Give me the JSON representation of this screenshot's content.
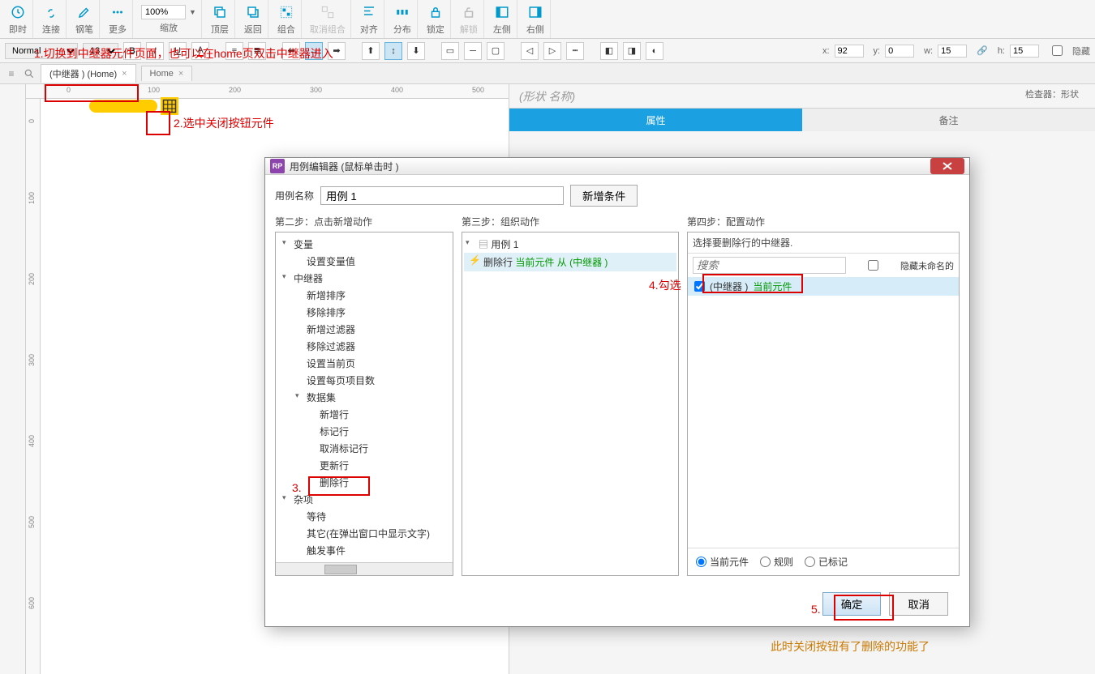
{
  "toolbar": {
    "groups": [
      {
        "label": "即时",
        "icon": "clock"
      },
      {
        "label": "连接",
        "icon": "link"
      },
      {
        "label": "钢笔",
        "icon": "pen"
      },
      {
        "label": "更多",
        "icon": "more"
      }
    ],
    "zoom": {
      "value": "100%",
      "label": "缩放"
    },
    "arrange": [
      {
        "label": "顶层",
        "icon": "front"
      },
      {
        "label": "返回",
        "icon": "back"
      },
      {
        "label": "组合",
        "icon": "group"
      },
      {
        "label": "取消组合",
        "icon": "ungroup"
      },
      {
        "label": "对齐",
        "icon": "align"
      },
      {
        "label": "分布",
        "icon": "distribute"
      },
      {
        "label": "锁定",
        "icon": "lock"
      },
      {
        "label": "解锁",
        "icon": "unlock"
      },
      {
        "label": "左侧",
        "icon": "left-panel"
      },
      {
        "label": "右侧",
        "icon": "right-panel"
      }
    ]
  },
  "format": {
    "style": "Normal",
    "font_size": "13",
    "x": "92",
    "y": "0",
    "w": "15",
    "h": "15",
    "hidden_label": "隐藏"
  },
  "tabs": {
    "active": "(中继器 ) (Home)",
    "inactive": "Home"
  },
  "ruler_h": [
    "0",
    "100",
    "200",
    "300",
    "400",
    "500"
  ],
  "ruler_v": [
    "0",
    "100",
    "200",
    "300",
    "400",
    "500",
    "600"
  ],
  "right_panel": {
    "inspector": "检查器：形状",
    "shape_name": "(形状  名称)",
    "tab_props": "属性",
    "tab_notes": "备注"
  },
  "annotations": {
    "a1": "1.切换到中继器元件页面，也可以在home页双击中继器进入",
    "a2": "2.选中关闭按钮元件",
    "a3": "3.",
    "a4": "4.勾选",
    "a5": "5.",
    "a_bottom": "此时关闭按钮有了删除的功能了"
  },
  "modal": {
    "title": "用例编辑器 (鼠标单击时  )",
    "case_label": "用例名称",
    "case_value": "用例 1",
    "add_condition": "新增条件",
    "step2": "第二步：点击新增动作",
    "step3": "第三步：组织动作",
    "step4": "第四步：配置动作",
    "actions_tree": {
      "variable": "变量",
      "set_var": "设置变量值",
      "repeater": "中继器",
      "repeater_items": [
        "新增排序",
        "移除排序",
        "新增过滤器",
        "移除过滤器",
        "设置当前页",
        "设置每页项目数"
      ],
      "dataset": "数据集",
      "dataset_items": [
        "新增行",
        "标记行",
        "取消标记行",
        "更新行",
        "删除行"
      ],
      "misc": "杂项",
      "misc_items": [
        "等待",
        "其它(在弹出窗口中显示文字)",
        "触发事件"
      ]
    },
    "organize": {
      "case": "用例 1",
      "action_prefix": "删除行",
      "action_mid": "当前元件",
      "action_from": "从",
      "action_target": "(中继器 )"
    },
    "config": {
      "prompt": "选择要删除行的中继器.",
      "search_placeholder": "搜索",
      "hide_unnamed": "隐藏未命名的",
      "item_name": "(中继器 )",
      "item_suffix": "当前元件",
      "radio_current": "当前元件",
      "radio_rule": "规则",
      "radio_marked": "已标记"
    },
    "ok": "确定",
    "cancel": "取消"
  }
}
